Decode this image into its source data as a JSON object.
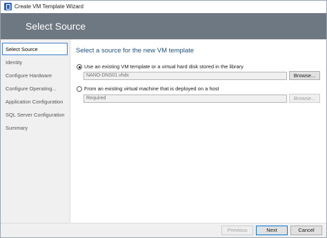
{
  "window": {
    "title": "Create VM Template Wizard"
  },
  "header": {
    "title": "Select Source"
  },
  "nav": {
    "items": [
      {
        "label": "Select Source",
        "active": true
      },
      {
        "label": "Identity",
        "active": false
      },
      {
        "label": "Configure Hardware",
        "active": false
      },
      {
        "label": "Configure Operating...",
        "active": false
      },
      {
        "label": "Application Configuration",
        "active": false
      },
      {
        "label": "SQL Server Configuration",
        "active": false
      },
      {
        "label": "Summary",
        "active": false
      }
    ]
  },
  "main": {
    "heading": "Select a source for the new VM template",
    "option_library": {
      "label": "Use an existing VM template or a virtual hard disk stored in the library",
      "checked": true,
      "value": "NANO-DNS01.vhdx",
      "browse_label": "Browse..."
    },
    "option_host": {
      "label": "From an existing virtual machine that is deployed on a host",
      "checked": false,
      "placeholder": "Required",
      "browse_label": "Browse..."
    }
  },
  "footer": {
    "previous_label": "Previous",
    "next_label": "Next",
    "cancel_label": "Cancel"
  },
  "colors": {
    "header_bg": "#6e7882",
    "heading_text": "#1f4f78",
    "nav_selected_border": "#3c7fd0",
    "primary_button_border": "#0078d7"
  },
  "icons": {
    "app_icon": "wizard-app-icon"
  }
}
